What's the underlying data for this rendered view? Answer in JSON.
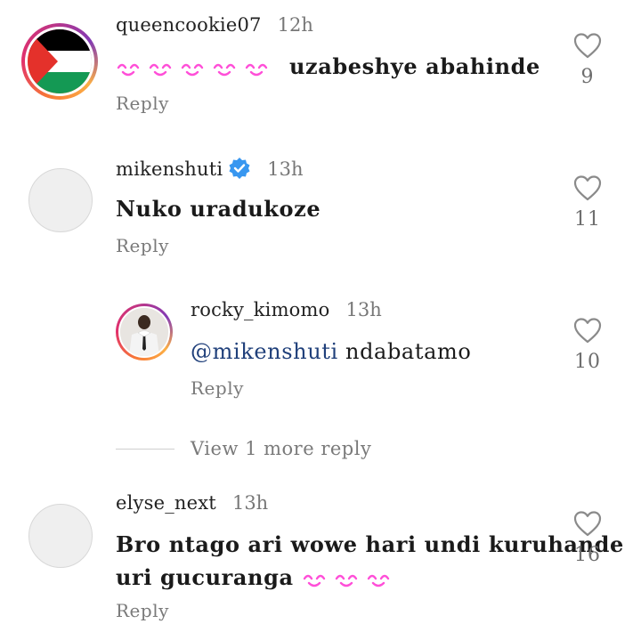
{
  "comments": [
    {
      "username": "queencookie07",
      "time": "12h",
      "text": "uzabeshye abahinde",
      "reply_label": "Reply",
      "likes": "9"
    },
    {
      "username": "mikenshuti",
      "time": "13h",
      "text": "Nuko uradukoze",
      "reply_label": "Reply",
      "likes": "11"
    },
    {
      "username": "rocky_kimomo",
      "time": "13h",
      "mention": "@mikenshuti",
      "text": " ndabatamo",
      "reply_label": "Reply",
      "likes": "10"
    },
    {
      "username": "elyse_next",
      "time": "13h",
      "text_line1": "Bro ntago ari wowe hari undi kuruhande",
      "text_line2": "uri gucuranga",
      "reply_label": "Reply",
      "likes": "16"
    }
  ],
  "view_more_label": "View 1 more reply",
  "colors": {
    "verified": "#3897f0",
    "emoji_pink": "#ff4fd8",
    "mention": "#1f3f7a"
  }
}
